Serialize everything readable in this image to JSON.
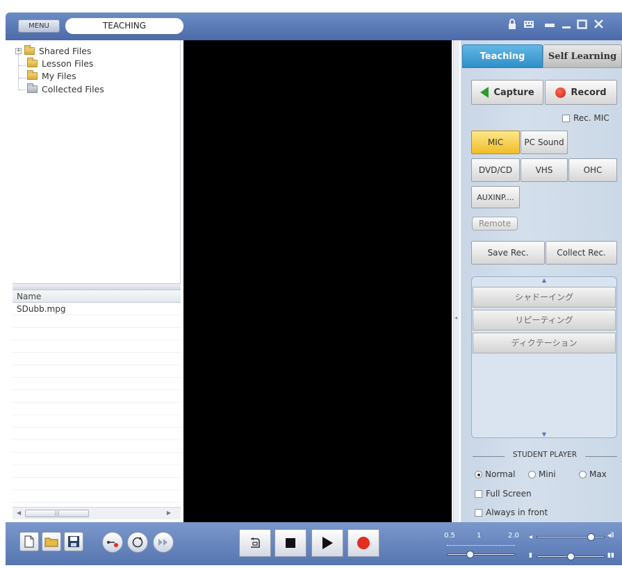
{
  "app": {
    "menu_label": "MENU",
    "mode_title": "TEACHING",
    "window_controls": [
      "lock-icon",
      "keyboard-icon",
      "restore-icon",
      "minimize-icon",
      "maximize-icon",
      "close-icon"
    ]
  },
  "tree": {
    "items": [
      {
        "label": "Shared Files",
        "icon": "folder-icon",
        "expandable": true
      },
      {
        "label": "Lesson Files",
        "icon": "folder-icon"
      },
      {
        "label": "My Files",
        "icon": "folder-icon"
      },
      {
        "label": "Collected Files",
        "icon": "collected-folder-icon"
      }
    ]
  },
  "filelist": {
    "header": "Name",
    "rows": [
      "SDubb.mpg"
    ]
  },
  "tabs": {
    "teaching": "Teaching",
    "self_learning": "Self Learning"
  },
  "record": {
    "capture": "Capture",
    "record": "Record",
    "rec_mic": "Rec. MIC"
  },
  "sources": {
    "mic": "MIC",
    "pc_sound": "PC Sound",
    "dvd_cd": "DVD/CD",
    "vhs": "VHS",
    "ohc": "OHC",
    "aux": "AUXINP....",
    "remote": "Remote",
    "active": "MIC"
  },
  "save": {
    "save_rec": "Save Rec.",
    "collect_rec": "Collect Rec."
  },
  "activities": [
    "シャドーイング",
    "リピーティング",
    "ディクテーション"
  ],
  "student_player": {
    "title": "STUDENT PLAYER",
    "normal": "Normal",
    "mini": "Mini",
    "max": "Max",
    "selected": "Normal",
    "full_screen": "Full Screen",
    "always_front": "Always in front"
  },
  "speed": {
    "min": "0.5",
    "mid": "1",
    "max": "2.0",
    "value": 1.0
  },
  "volume": {
    "level": 0.8,
    "balance": 0.5
  },
  "colors": {
    "titlebar": "#5675b0",
    "teaching_tab": "#2f8fc9",
    "active_source": "#f0bd27",
    "record_red": "#d21b10",
    "capture_green": "#2c9b2c"
  }
}
